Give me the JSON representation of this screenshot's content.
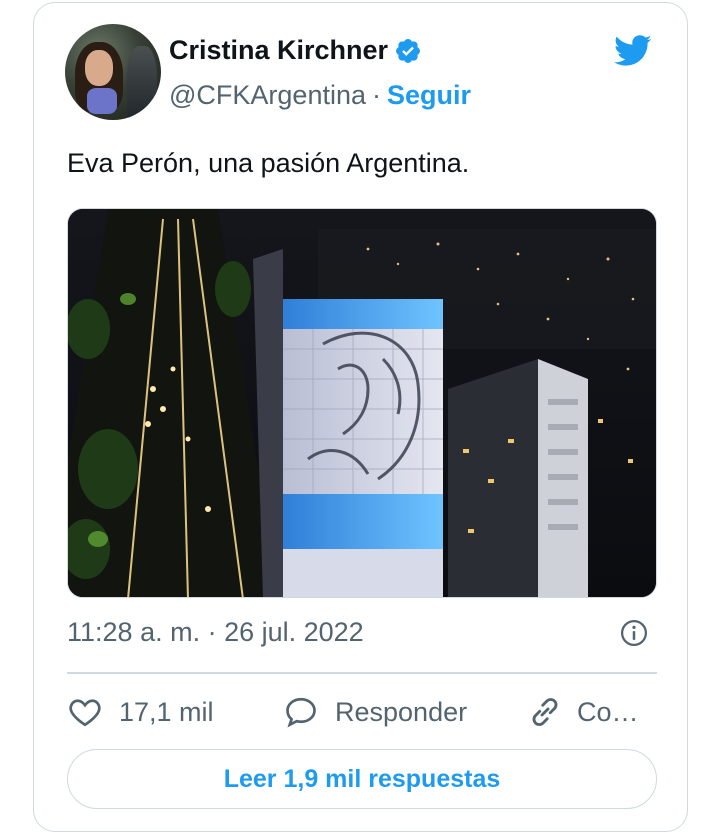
{
  "author": {
    "name": "Cristina Kirchner",
    "handle": "@CFKArgentina",
    "separator": "·",
    "follow_label": "Seguir"
  },
  "tweet": {
    "text": "Eva Perón, una pasión Argentina.",
    "timestamp": "11:28 a. m. · 26 jul. 2022"
  },
  "actions": {
    "like_count": "17,1 mil",
    "reply_label": "Responder",
    "copy_label": "Co…"
  },
  "read_replies_label": "Leer 1,9 mil respuestas",
  "icons": {
    "verified": "verified-badge-icon",
    "brand": "twitter-bird-icon",
    "info": "info-icon",
    "like": "heart-icon",
    "reply": "speech-bubble-icon",
    "copy": "link-icon"
  },
  "colors": {
    "accent": "#1d9bf0",
    "text": "#0f1419",
    "secondary": "#536471",
    "border": "#cfd9de"
  }
}
